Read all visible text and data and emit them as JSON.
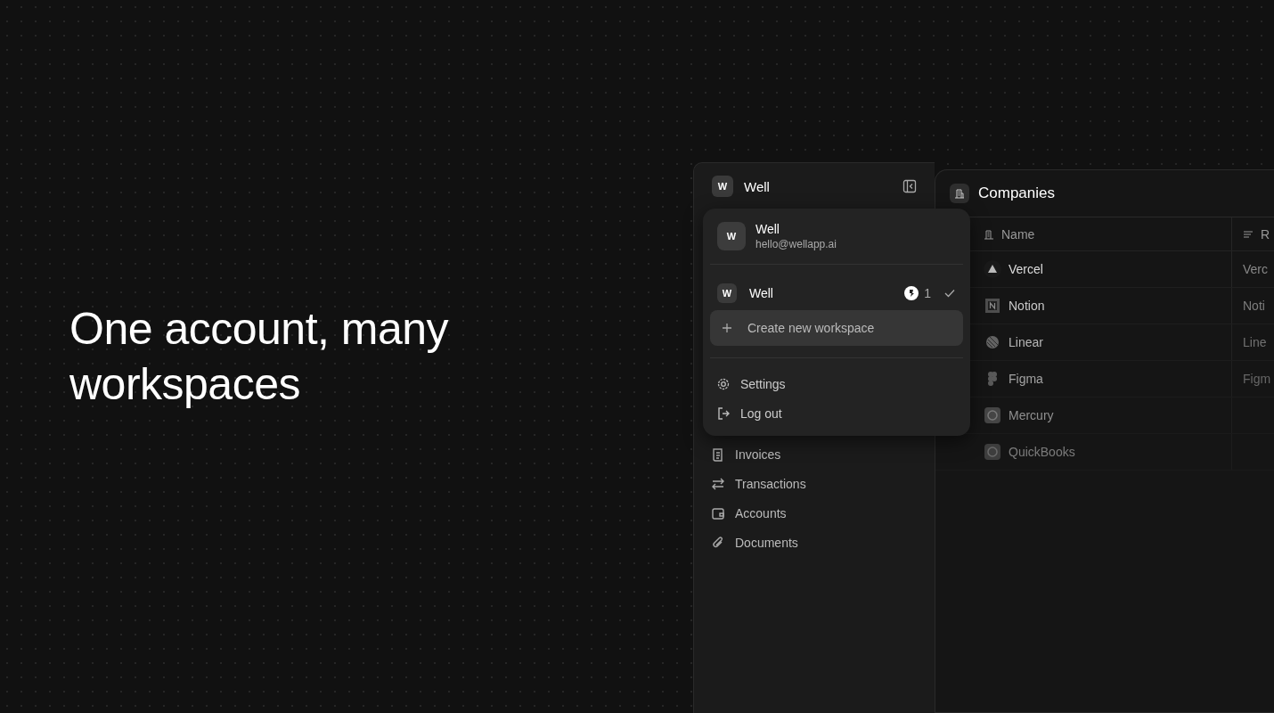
{
  "headline": "One account, many workspaces",
  "sidebar": {
    "workspace": {
      "initial": "W",
      "name": "Well"
    },
    "items": [
      {
        "kind": "invoices",
        "label": "Invoices"
      },
      {
        "kind": "transactions",
        "label": "Transactions"
      },
      {
        "kind": "accounts",
        "label": "Accounts"
      },
      {
        "kind": "documents",
        "label": "Documents"
      }
    ]
  },
  "account_menu": {
    "profile": {
      "initial": "W",
      "name": "Well",
      "email": "hello@wellapp.ai"
    },
    "workspaces": [
      {
        "initial": "W",
        "name": "Well",
        "members": "1",
        "selected": true
      }
    ],
    "create": {
      "label": "Create new workspace",
      "highlighted": true
    },
    "actions": [
      {
        "kind": "settings",
        "label": "Settings"
      },
      {
        "kind": "logout",
        "label": "Log out"
      }
    ]
  },
  "companies": {
    "title": "Companies",
    "columns": [
      "Name",
      "R"
    ],
    "rows": [
      {
        "name": "Vercel",
        "column_2": "Verc"
      },
      {
        "name": "Notion",
        "column_2": "Noti"
      },
      {
        "name": "Linear",
        "column_2": "Line"
      },
      {
        "name": "Figma",
        "column_2": "Figm"
      },
      {
        "name": "Mercury"
      },
      {
        "name": "QuickBooks"
      }
    ]
  }
}
